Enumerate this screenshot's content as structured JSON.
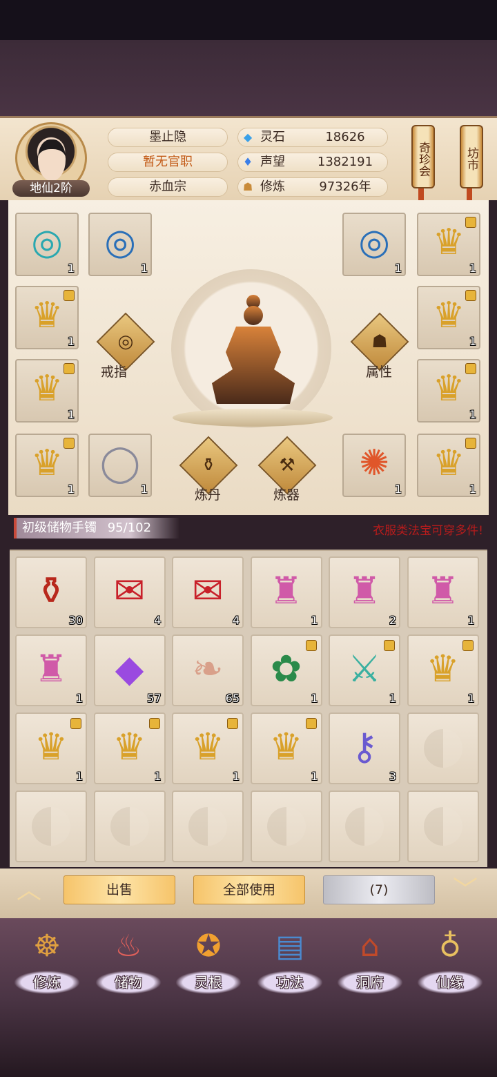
{
  "header": {
    "level": "地仙2阶",
    "name": "墨止隐",
    "office": "暂无官职",
    "sect": "赤血宗",
    "resources": [
      {
        "label": "灵石",
        "value": "18626",
        "icon": "spirit-stone-icon"
      },
      {
        "label": "声望",
        "value": "1382191",
        "icon": "reputation-icon"
      },
      {
        "label": "修炼",
        "value": "97326年",
        "icon": "cultivation-icon"
      }
    ],
    "side_buttons": [
      {
        "label": "奇珍会"
      },
      {
        "label": "坊市"
      }
    ]
  },
  "equipment": {
    "left_slots": [
      {
        "item": "jade-ring-gold",
        "count": "1",
        "locked": false
      },
      {
        "item": "jade-ring-blue",
        "count": "1",
        "locked": false
      },
      {
        "item": "golden-robe",
        "count": "1",
        "locked": true
      },
      {
        "item": "golden-robe",
        "count": "1",
        "locked": true
      },
      {
        "item": "golden-robe",
        "count": "1",
        "locked": true
      },
      {
        "item": "pearl-ring",
        "count": "1",
        "locked": false
      }
    ],
    "right_slots": [
      {
        "item": "jade-ring-blue",
        "count": "1",
        "locked": false
      },
      {
        "item": "golden-robe",
        "count": "1",
        "locked": true
      },
      {
        "item": "golden-robe",
        "count": "1",
        "locked": true
      },
      {
        "item": "golden-robe",
        "count": "1",
        "locked": true
      },
      {
        "item": "fire-ring",
        "count": "1",
        "locked": false
      },
      {
        "item": "golden-robe",
        "count": "1",
        "locked": true
      }
    ],
    "functions": {
      "ring": "戒指",
      "attributes": "属性",
      "alchemy": "炼丹",
      "forging": "炼器"
    }
  },
  "bag": {
    "name": "初级储物手镯",
    "capacity": "95/102",
    "note": "衣服类法宝可穿多件!",
    "items": [
      {
        "item": "red-teapot",
        "count": "30",
        "locked": false
      },
      {
        "item": "scroll-ru",
        "count": "4",
        "locked": false
      },
      {
        "item": "scroll-yi",
        "count": "4",
        "locked": false
      },
      {
        "item": "tassel-scroll",
        "count": "1",
        "locked": false
      },
      {
        "item": "tassel-scroll",
        "count": "2",
        "locked": false
      },
      {
        "item": "tassel-scroll",
        "count": "1",
        "locked": false
      },
      {
        "item": "tassel-scroll",
        "count": "1",
        "locked": false
      },
      {
        "item": "purple-crystal",
        "count": "57",
        "locked": false
      },
      {
        "item": "paper-scroll",
        "count": "65",
        "locked": false
      },
      {
        "item": "leaf-robe",
        "count": "1",
        "locked": true
      },
      {
        "item": "jade-sword",
        "count": "1",
        "locked": true
      },
      {
        "item": "golden-robe",
        "count": "1",
        "locked": true
      },
      {
        "item": "golden-robe",
        "count": "1",
        "locked": true
      },
      {
        "item": "golden-robe",
        "count": "1",
        "locked": true
      },
      {
        "item": "golden-robe",
        "count": "1",
        "locked": true
      },
      {
        "item": "golden-robe",
        "count": "1",
        "locked": true
      },
      {
        "item": "talisman-pendant",
        "count": "3",
        "locked": false
      },
      {
        "item": "",
        "count": "",
        "locked": false
      },
      {
        "item": "",
        "count": "",
        "locked": false
      },
      {
        "item": "",
        "count": "",
        "locked": false
      },
      {
        "item": "",
        "count": "",
        "locked": false
      },
      {
        "item": "",
        "count": "",
        "locked": false
      },
      {
        "item": "",
        "count": "",
        "locked": false
      },
      {
        "item": "",
        "count": "",
        "locked": false
      }
    ]
  },
  "actions": {
    "sell": "出售",
    "use_all": "全部使用",
    "count": "(7)"
  },
  "nav": [
    {
      "label": "修炼",
      "icon": "monk-icon"
    },
    {
      "label": "储物",
      "icon": "bag-icon"
    },
    {
      "label": "灵根",
      "icon": "spirit-root-icon"
    },
    {
      "label": "功法",
      "icon": "book-icon"
    },
    {
      "label": "洞府",
      "icon": "cave-house-icon"
    },
    {
      "label": "仙缘",
      "icon": "gourd-icon"
    }
  ],
  "colors": {
    "accent_gold": "#f6c46a",
    "note_red": "#b81c1c",
    "office_orange": "#c25a16"
  }
}
